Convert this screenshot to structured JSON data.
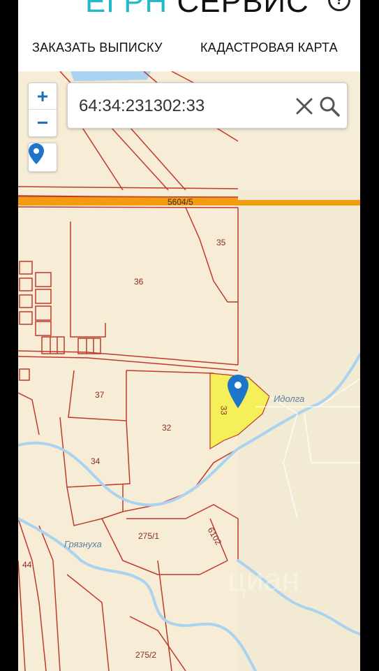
{
  "header": {
    "logo_part1": "ЕГРН",
    "logo_part2": " СЕРВИС",
    "help_icon": "?",
    "nav": {
      "order_statement": "ЗАКАЗАТЬ ВЫПИСКУ",
      "cadastral_map": "КАДАСТРОВАЯ КАРТА"
    }
  },
  "map": {
    "zoom_in": "+",
    "zoom_out": "−",
    "search_value": "64:34:231302:33",
    "labels": {
      "road": "5604/5",
      "p35": "35",
      "p36": "36",
      "p37": "37",
      "p32": "32",
      "p33": "33",
      "p34": "34",
      "p275_1": "275/1",
      "p6102": "6102",
      "p44": "44",
      "p275_2": "275/2",
      "river1": "Идолга",
      "river2": "Грязнуха"
    },
    "watermark": "циан",
    "colors": {
      "parcel_border": "#c0392b",
      "selected_parcel": "#f5f05a",
      "road": "#f39c12",
      "river": "#a9d3ee",
      "marker": "#1e74c8"
    }
  }
}
